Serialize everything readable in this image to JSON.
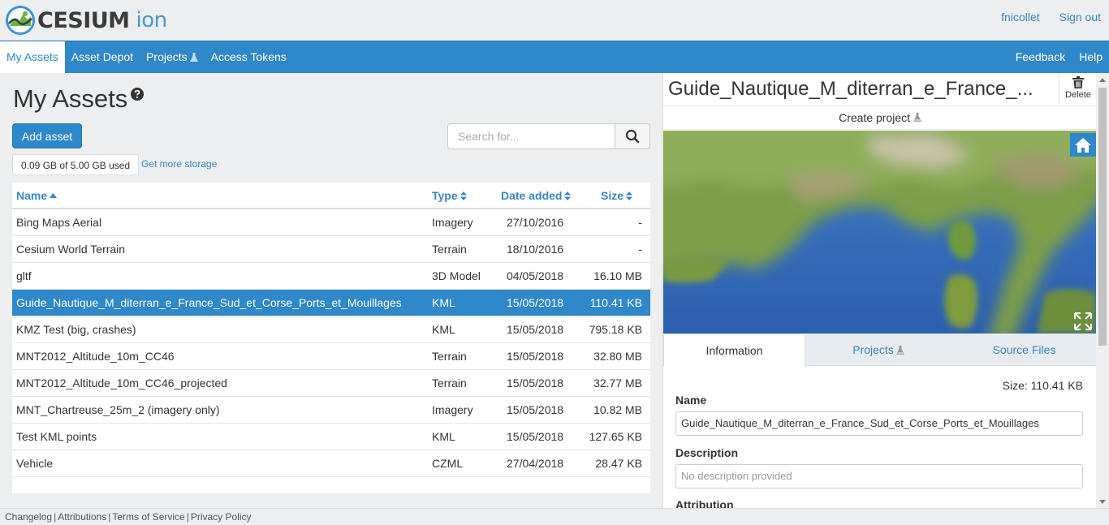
{
  "brand": {
    "name": "CESIUM",
    "product": "ion"
  },
  "user": {
    "username": "fnicollet",
    "signout_label": "Sign out"
  },
  "nav": {
    "items": [
      {
        "label": "My Assets",
        "active": true
      },
      {
        "label": "Asset Depot"
      },
      {
        "label": "Projects",
        "flask": true
      },
      {
        "label": "Access Tokens"
      }
    ],
    "right": [
      {
        "label": "Feedback"
      },
      {
        "label": "Help"
      }
    ]
  },
  "assets_page": {
    "title": "My Assets",
    "add_button": "Add asset",
    "search_placeholder": "Search for...",
    "storage_used": "0.09 GB of 5.00 GB used",
    "more_storage": "Get more storage",
    "columns": {
      "name": "Name",
      "type": "Type",
      "date": "Date added",
      "size": "Size"
    },
    "rows": [
      {
        "name": "Bing Maps Aerial",
        "type": "Imagery",
        "date": "27/10/2016",
        "size": "-"
      },
      {
        "name": "Cesium World Terrain",
        "type": "Terrain",
        "date": "18/10/2016",
        "size": "-"
      },
      {
        "name": "gltf",
        "type": "3D Model",
        "date": "04/05/2018",
        "size": "16.10 MB"
      },
      {
        "name": "Guide_Nautique_M_diterran_e_France_Sud_et_Corse_Ports_et_Mouillages",
        "type": "KML",
        "date": "15/05/2018",
        "size": "110.41 KB",
        "selected": true
      },
      {
        "name": "KMZ Test (big, crashes)",
        "type": "KML",
        "date": "15/05/2018",
        "size": "795.18 KB"
      },
      {
        "name": "MNT2012_Altitude_10m_CC46",
        "type": "Terrain",
        "date": "15/05/2018",
        "size": "32.80 MB"
      },
      {
        "name": "MNT2012_Altitude_10m_CC46_projected",
        "type": "Terrain",
        "date": "15/05/2018",
        "size": "32.77 MB"
      },
      {
        "name": "MNT_Chartreuse_25m_2 (imagery only)",
        "type": "Imagery",
        "date": "15/05/2018",
        "size": "10.82 MB"
      },
      {
        "name": "Test KML points",
        "type": "KML",
        "date": "15/05/2018",
        "size": "127.65 KB"
      },
      {
        "name": "Vehicle",
        "type": "CZML",
        "date": "27/04/2018",
        "size": "28.47 KB"
      }
    ]
  },
  "detail": {
    "title": "Guide_Nautique_M_diterran_e_France_...",
    "delete_label": "Delete",
    "create_project": "Create project",
    "tabs": [
      {
        "label": "Information",
        "active": true
      },
      {
        "label": "Projects",
        "flask": true
      },
      {
        "label": "Source Files"
      }
    ],
    "size_text": "Size: 110.41 KB",
    "name_label": "Name",
    "name_value": "Guide_Nautique_M_diterran_e_France_Sud_et_Corse_Ports_et_Mouillages",
    "description_label": "Description",
    "description_placeholder": "No description provided",
    "attribution_label": "Attribution"
  },
  "footer": {
    "links": [
      "Changelog",
      "Attributions",
      "Terms of Service",
      "Privacy Policy"
    ]
  },
  "colors": {
    "accent": "#2e88c9",
    "link": "#3b86c6",
    "selected_row": "#2e88c9"
  }
}
